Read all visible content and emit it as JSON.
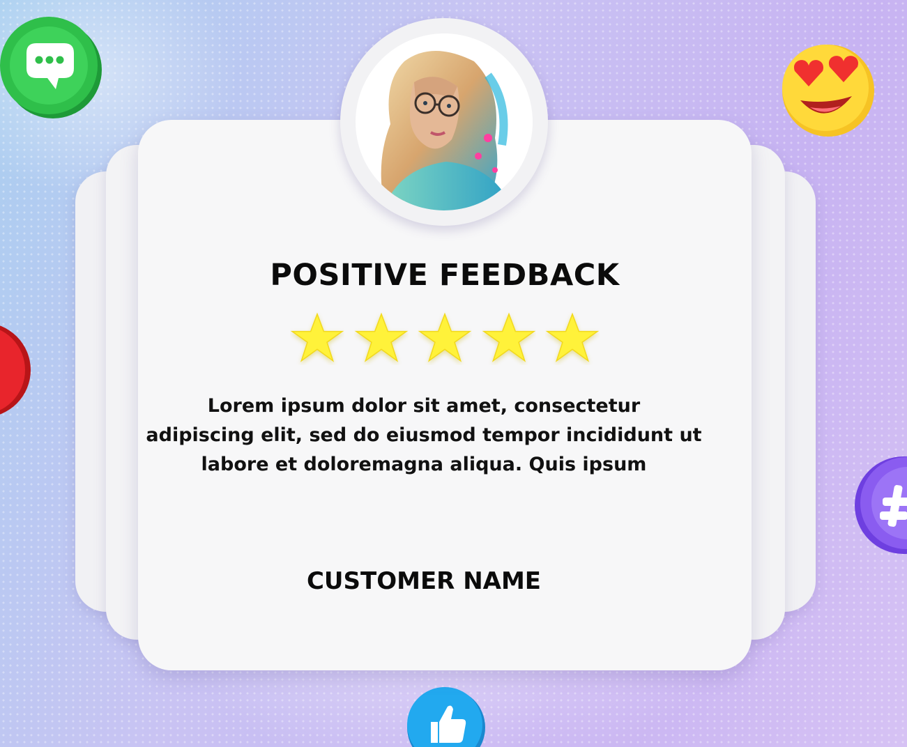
{
  "card": {
    "title": "POSITIVE FEEDBACK",
    "rating": 5,
    "rating_max": 5,
    "text_lines": [
      "Lorem ipsum dolor sit amet, consectetur",
      "adipiscing elit, sed do eiusmod tempor incididunt ut",
      "labore et doloremagna aliqua. Quis ipsum"
    ],
    "customer_name": "CUSTOMER NAME"
  },
  "colors": {
    "star": "#fff23a",
    "chat_bubble": "#2fbf4a",
    "heart_emoji": "#f6c324",
    "hashtag": "#8a5cf0",
    "thumbs_up": "#22a9ef",
    "red_bubble": "#e8252c"
  },
  "icons": [
    "chat-bubble-icon",
    "heart-eyes-emoji-icon",
    "hashtag-icon",
    "thumbs-up-icon",
    "red-bubble-icon"
  ]
}
